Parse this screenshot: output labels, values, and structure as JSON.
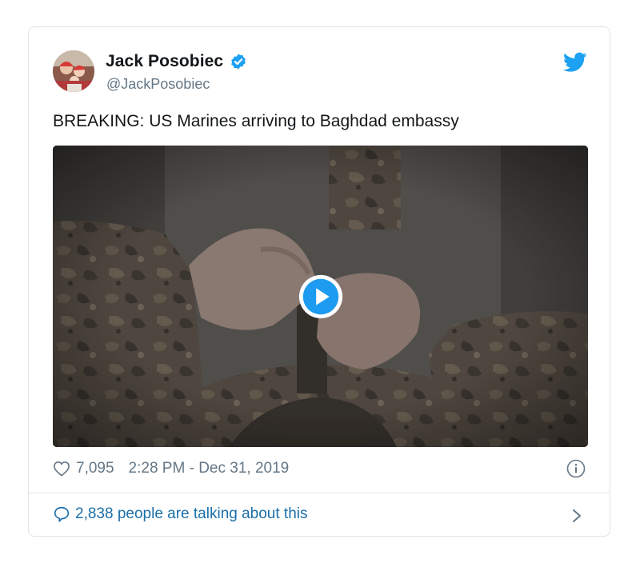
{
  "tweet": {
    "author_name": "Jack Posobiec",
    "handle": "@JackPosobiec",
    "text": "BREAKING: US Marines arriving to Baghdad embassy",
    "likes": "7,095",
    "timestamp": "2:28 PM - Dec 31, 2019",
    "talking": "2,838 people are talking about this"
  },
  "icons": {
    "verified": "verified-badge-icon",
    "brand": "twitter-bird-icon",
    "play": "play-icon",
    "like": "heart-icon",
    "info": "info-icon",
    "reply": "speech-bubble-icon",
    "chevron": "chevron-right-icon"
  },
  "colors": {
    "twitter_blue": "#1da1f2",
    "link_blue": "#1b6fa8",
    "secondary_text": "#657786"
  }
}
